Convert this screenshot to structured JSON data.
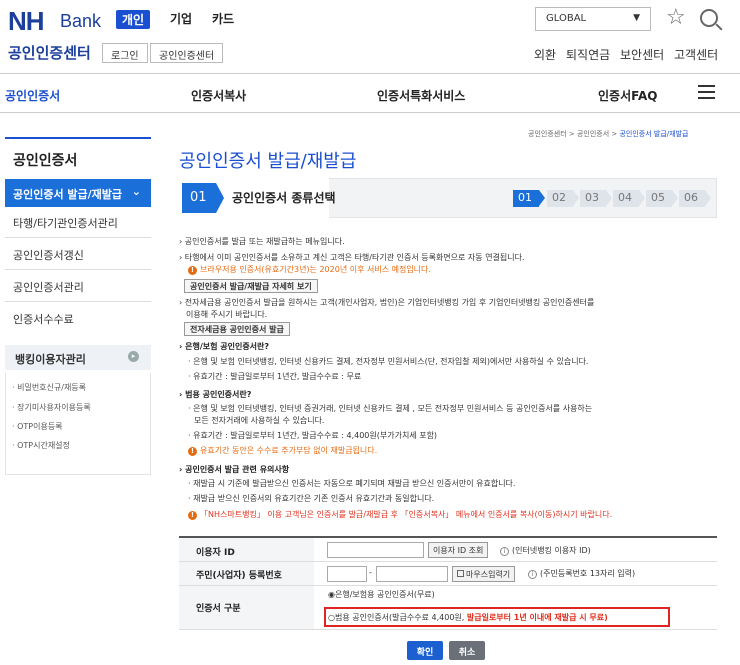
{
  "header": {
    "logo_nh": "NH",
    "logo_bank": "Bank",
    "tabs": [
      "개인",
      "기업",
      "카드"
    ],
    "global_select": "GLOBAL",
    "cert_center": "공인인증센터",
    "login_btn": "로그인",
    "cert_center_btn": "공인인증센터",
    "util_links": [
      "외환",
      "퇴직연금",
      "보안센터",
      "고객센터"
    ]
  },
  "gnb": [
    "공인인증서",
    "인증서복사",
    "인증서특화서비스",
    "인증서FAQ"
  ],
  "lnb": {
    "title": "공인인증서",
    "active": "공인인증서 발급/재발급",
    "items": [
      "타행/타기관인증서관리",
      "공인인증서갱신",
      "공인인증서관리",
      "인증서수수료"
    ],
    "banking_title": "뱅킹이용자관리",
    "banking_items": [
      "비밀번호신규/재등록",
      "장기미사용자이용등록",
      "OTP이용등록",
      "OTP시간재설정"
    ]
  },
  "breadcrumb": {
    "path": "공인인증센터 > 공인인증서 > ",
    "current": "공인인증서 발급/재발급"
  },
  "page_title": "공인인증서 발급/재발급",
  "step": {
    "current_num": "01",
    "current_label": "공인인증서 종류선택",
    "steps": [
      "01",
      "02",
      "03",
      "04",
      "05",
      "06"
    ],
    "active_index": 0
  },
  "content": {
    "l1": "공인인증서를 발급 또는 재발급하는 메뉴입니다.",
    "l2": "타행에서 이미 공인인증서를 소유하고 계신 고객은 타행/타기관 인증서 등록화면으로 자동 연결됩니다.",
    "l3": "브라우저용 인증서(유효기간3년)는 2020년 이후 서비스 예정입니다.",
    "btn1": "공인인증서 발급/재발급 자세히 보기",
    "l4": "전자세금용 공인인증서 발급을 원하시는 고객(개인사업자, 법인)은 기업인터넷뱅킹 가입 후 기업인터넷뱅킹 공인인증센터를",
    "l5": "이용해 주시기 바랍니다.",
    "btn2": "전자세금용 공인인증서 발급",
    "h1": "은행/보험 공인인증서란?",
    "h1_a": "· 은행 및 보험 인터넷뱅킹, 인터넷 신용카드 결제, 전자정부 민원서비스(단, 전자입찰 제외)에서만 사용하실 수 있습니다.",
    "h1_b": "· 유효기간 : 발급일로부터 1년간, 발급수수료 : 무료",
    "h2": "범용 공인인증서란?",
    "h2_a": "· 은행 및 보험 인터넷뱅킹, 인터넷 증권거래, 인터넷 신용카드 결제 , 모든 전자정부 민원서비스 등 공인인증서를 사용하는",
    "h2_b": "모든 전자거래에 사용하실 수 있습니다.",
    "h2_c": "· 유효기간 : 발급일로부터 1년간, 발급수수료 : 4,400원(부가가치세 포함)",
    "h2_d": "유효기간 동안은 수수료 추가부담 없이 재발급됩니다.",
    "h3": "공인인증서 발급 관련 유의사항",
    "h3_a": "· 재발급 시 기준에 발급받으신 인증서는 자동으로 폐기되며 재발급 받으신 인증서만이 유효합니다.",
    "h3_b": "· 재발급 받으신 인증서의 유효기간은 기존 인증서 유효기간과 동일합니다.",
    "h3_c": "「NH스마트뱅킹」 이용 고객님은 인증서를 발급/재발급 후 「인증서복사」 메뉴에서 인증서를 복사(이동)하시기 바랍니다."
  },
  "form": {
    "user_id_label": "이용자 ID",
    "user_id_btn": "이용자 ID 조회",
    "user_id_help": "(인터넷뱅킹 이용자 ID)",
    "rrn_label": "주민(사업자) 등록번호",
    "rrn_dash": "-",
    "mouse_input": "마우스입력기",
    "rrn_help": "(주민등록번호 13자리 입력)",
    "cert_type_label": "인증서 구분",
    "option1": "◉은행/보험용 공인인증서(무료)",
    "option2_a": "○범용 공인인증서(발급수수료 4,400원, ",
    "option2_b": "발급일로부터 1년 이내에 재발급 시 무료)"
  },
  "buttons": {
    "confirm": "확인",
    "cancel": "취소"
  }
}
